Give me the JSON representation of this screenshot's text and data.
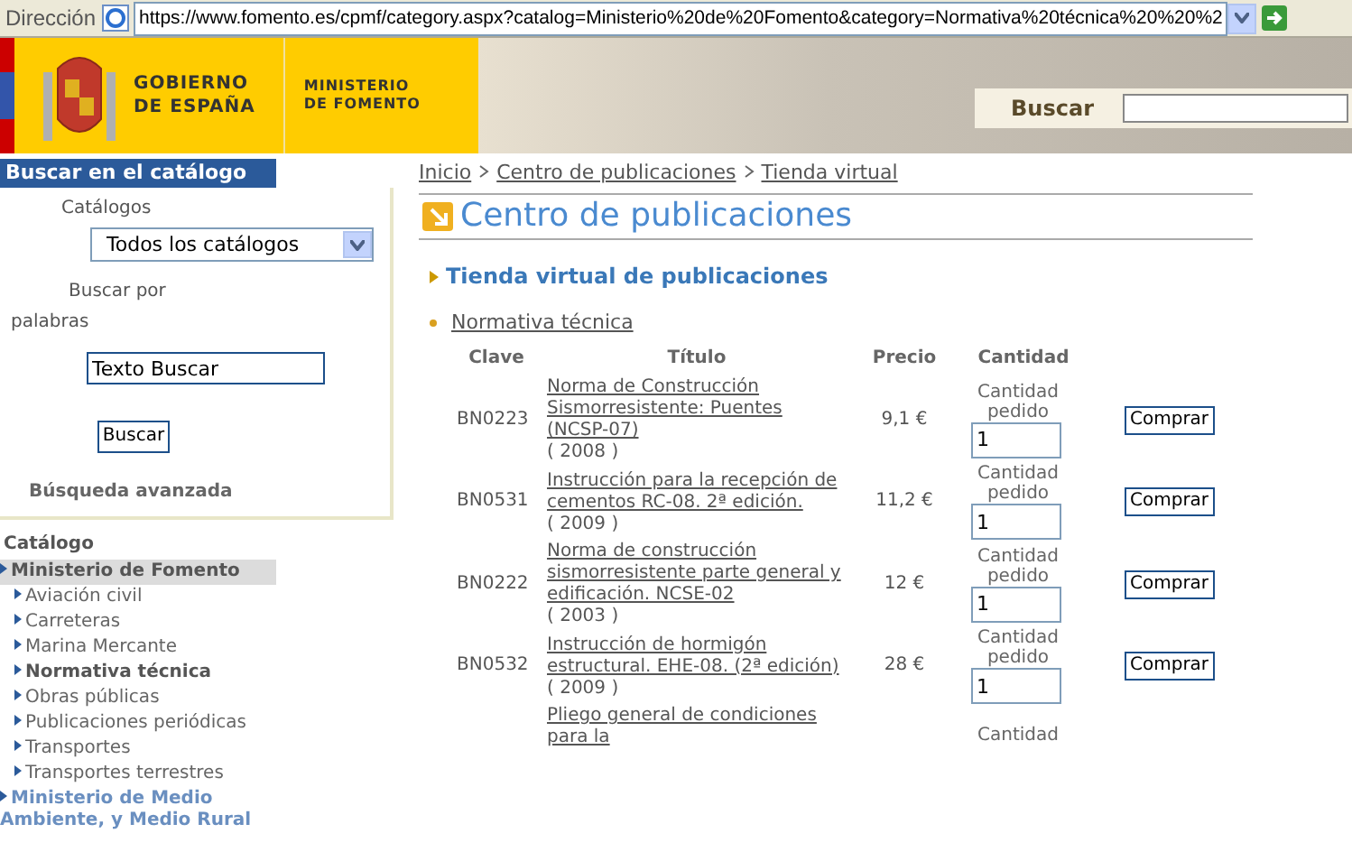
{
  "address_bar": {
    "label": "Dirección",
    "url": "https://www.fomento.es/cpmf/category.aspx?catalog=Ministerio%20de%20Fomento&category=Normativa%20técnica%20%20%2"
  },
  "header": {
    "gobierno": "GOBIERNO\nDE ESPAÑA",
    "ministerio": "MINISTERIO\nDE FOMENTO",
    "search_label": "Buscar"
  },
  "search_panel": {
    "title": "Buscar en el catálogo",
    "catalog_label": "Catálogos",
    "catalog_value": "Todos los catálogos",
    "words_label": "Buscar por palabras",
    "words_value": "Texto Buscar",
    "button": "Buscar",
    "advanced": "Búsqueda avanzada"
  },
  "catalog": {
    "title": "Catálogo",
    "items": [
      {
        "label": "Ministerio de Fomento",
        "expanded": true,
        "selected": true,
        "children": [
          {
            "label": "Aviación civil",
            "selected": false
          },
          {
            "label": "Carreteras",
            "selected": false
          },
          {
            "label": "Marina Mercante",
            "selected": false
          },
          {
            "label": "Normativa técnica",
            "selected": true
          },
          {
            "label": "Obras públicas",
            "selected": false
          },
          {
            "label": "Publicaciones periódicas",
            "selected": false
          },
          {
            "label": "Transportes",
            "selected": false
          },
          {
            "label": "Transportes terrestres",
            "selected": false
          }
        ]
      },
      {
        "label": "Ministerio de Medio Ambiente, y Medio Rural",
        "expanded": false,
        "selected": false
      }
    ]
  },
  "breadcrumb": [
    "Inicio",
    "Centro de publicaciones",
    "Tienda virtual"
  ],
  "page_title": "Centro de publicaciones",
  "section_title": "Tienda virtual de publicaciones",
  "category_link": "Normativa técnica",
  "table": {
    "columns": [
      "Clave",
      "Título",
      "Precio",
      "Cantidad"
    ],
    "rows": [
      {
        "code": "BN0223",
        "title": "Norma de Construcción Sismorresistente: Puentes (NCSP-07)",
        "year": "( 2008 )",
        "price": "9,1 €",
        "quantity_label": "Cantidad pedido",
        "quantity": "1",
        "button": "Comprar"
      },
      {
        "code": "BN0531",
        "title": "Instrucción para la recepción de cementos RC-08. 2ª edición.",
        "year": "( 2009 )",
        "price": "11,2 €",
        "quantity_label": "Cantidad pedido",
        "quantity": "1",
        "button": "Comprar"
      },
      {
        "code": "BN0222",
        "title": "Norma de construcción sismorresistente parte general y edificación. NCSE-02",
        "year": "( 2003 )",
        "price": "12 €",
        "quantity_label": "Cantidad pedido",
        "quantity": "1",
        "button": "Comprar"
      },
      {
        "code": "BN0532",
        "title": "Instrucción de hormigón estructural. EHE-08. (2ª edición)",
        "year": "( 2009 )",
        "price": "28 €",
        "quantity_label": "Cantidad pedido",
        "quantity": "1",
        "button": "Comprar"
      },
      {
        "title": "Pliego general de condiciones para la",
        "quantity_label": "Cantidad"
      }
    ]
  }
}
